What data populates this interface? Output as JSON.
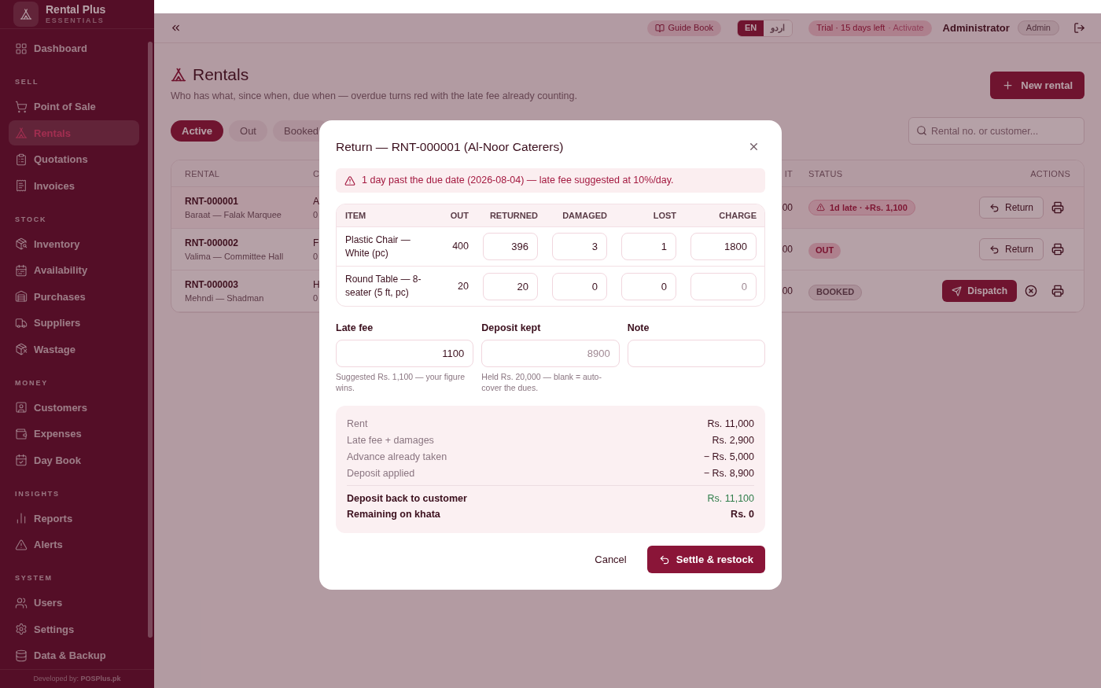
{
  "sidebar": {
    "brand": {
      "name": "Rental Plus",
      "edition": "ESSENTIALS"
    },
    "sections": [
      {
        "items": [
          {
            "label": "Dashboard",
            "selected": false
          }
        ]
      },
      {
        "title": "SELL",
        "items": [
          {
            "label": "Point of Sale",
            "selected": false
          },
          {
            "label": "Rentals",
            "selected": true
          },
          {
            "label": "Quotations",
            "selected": false
          },
          {
            "label": "Invoices",
            "selected": false
          }
        ]
      },
      {
        "title": "STOCK",
        "items": [
          {
            "label": "Inventory",
            "selected": false
          },
          {
            "label": "Availability",
            "selected": false
          },
          {
            "label": "Purchases",
            "selected": false
          },
          {
            "label": "Suppliers",
            "selected": false
          },
          {
            "label": "Wastage",
            "selected": false
          }
        ]
      },
      {
        "title": "MONEY",
        "items": [
          {
            "label": "Customers",
            "selected": false
          },
          {
            "label": "Expenses",
            "selected": false
          },
          {
            "label": "Day Book",
            "selected": false
          }
        ]
      },
      {
        "title": "INSIGHTS",
        "items": [
          {
            "label": "Reports",
            "selected": false
          },
          {
            "label": "Alerts",
            "selected": false
          }
        ]
      },
      {
        "title": "SYSTEM",
        "items": [
          {
            "label": "Users",
            "selected": false
          },
          {
            "label": "Settings",
            "selected": false
          },
          {
            "label": "Data & Backup",
            "selected": false
          }
        ]
      }
    ],
    "footer": "Developed by: **POSPlus.pk**"
  },
  "topbar": {
    "guide": "Guide Book",
    "languages": [
      {
        "label": "EN",
        "selected": true
      },
      {
        "label": "اردو",
        "selected": false
      }
    ],
    "trial": "Trial · 15 days left",
    "activate": "· Activate",
    "user": "Administrator",
    "role": "Admin"
  },
  "page": {
    "title": "Rentals",
    "subtitle": "Who has what, since when, due when — overdue turns red with the late fee already counting.",
    "new_button": "New rental",
    "tabs": [
      {
        "label": "Active",
        "selected": true
      },
      {
        "label": "Out",
        "selected": false
      },
      {
        "label": "Booked",
        "selected": false
      }
    ],
    "search": {
      "placeholder": "Rental no. or customer..."
    }
  },
  "table": {
    "columns": [
      "RENTAL",
      "C",
      "IT",
      "STATUS",
      "ACTIONS"
    ],
    "rows": [
      {
        "rental": "RNT-000001",
        "event": "Baraat — Falak Marquee",
        "column_2": "A",
        "column_2_sub": "0",
        "column_3": "00",
        "status": {
          "kind": "late",
          "label": "1d late · +Rs. 1,100"
        },
        "actions": [
          {
            "kind": "return",
            "label": "Return"
          },
          {
            "kind": "print"
          }
        ]
      },
      {
        "rental": "RNT-000002",
        "event": "Valima — Committee Hall",
        "column_2": "F",
        "column_2_sub": "0",
        "column_3": "00",
        "status": {
          "kind": "out",
          "label": "OUT"
        },
        "actions": [
          {
            "kind": "return",
            "label": "Return"
          },
          {
            "kind": "print"
          }
        ]
      },
      {
        "rental": "RNT-000003",
        "event": "Mehndi — Shadman",
        "column_2": "H",
        "column_2_sub": "0",
        "column_3": "00",
        "status": {
          "kind": "booked",
          "label": "BOOKED"
        },
        "actions": [
          {
            "kind": "dispatch",
            "label": "Dispatch"
          },
          {
            "kind": "cancel"
          },
          {
            "kind": "print"
          }
        ]
      }
    ]
  },
  "dialog": {
    "title": "Return — RNT-000001 (Al-Noor Caterers)",
    "warning": "1 day past the due date (2026-08-04) — late fee suggested at 10%/day.",
    "columns": [
      "ITEM",
      "OUT",
      "RETURNED",
      "DAMAGED",
      "LOST",
      "CHARGE"
    ],
    "items": [
      {
        "item": "Plastic Chair — White (pc)",
        "out": "400",
        "returned": {
          "value": "396"
        },
        "damaged": {
          "value": "3"
        },
        "lost": {
          "value": "1"
        },
        "charge": {
          "value": "1800"
        }
      },
      {
        "item": "Round Table — 8-seater (5 ft, pc)",
        "out": "20",
        "returned": {
          "value": "20"
        },
        "damaged": {
          "value": "0"
        },
        "lost": {
          "value": "0"
        },
        "charge": {
          "placeholder": "0"
        }
      }
    ],
    "fields": [
      {
        "label": "Late fee",
        "value": "1100",
        "hint": "Suggested Rs. 1,100 — your figure wins."
      },
      {
        "label": "Deposit kept",
        "placeholder": "8900",
        "hint": "Held Rs. 20,000 — blank = auto-cover the dues."
      },
      {
        "label": "Note"
      }
    ],
    "summary": [
      {
        "kind": "line",
        "label": "Rent",
        "amount": "Rs. 11,000",
        "positive": false
      },
      {
        "kind": "line",
        "label": "Late fee + damages",
        "amount": "Rs. 2,900",
        "positive": false
      },
      {
        "kind": "line",
        "label": "Advance already taken",
        "amount": "− Rs. 5,000",
        "positive": false
      },
      {
        "kind": "line",
        "label": "Deposit applied",
        "amount": "− Rs. 8,900",
        "positive": false
      },
      {
        "kind": "total",
        "label": "Deposit back to customer",
        "amount": "Rs. 11,100",
        "positive": true
      },
      {
        "kind": "total",
        "label": "Remaining on khata",
        "amount": "Rs. 0",
        "positive": false
      }
    ],
    "cancel": "Cancel",
    "confirm": "Settle & restock"
  }
}
